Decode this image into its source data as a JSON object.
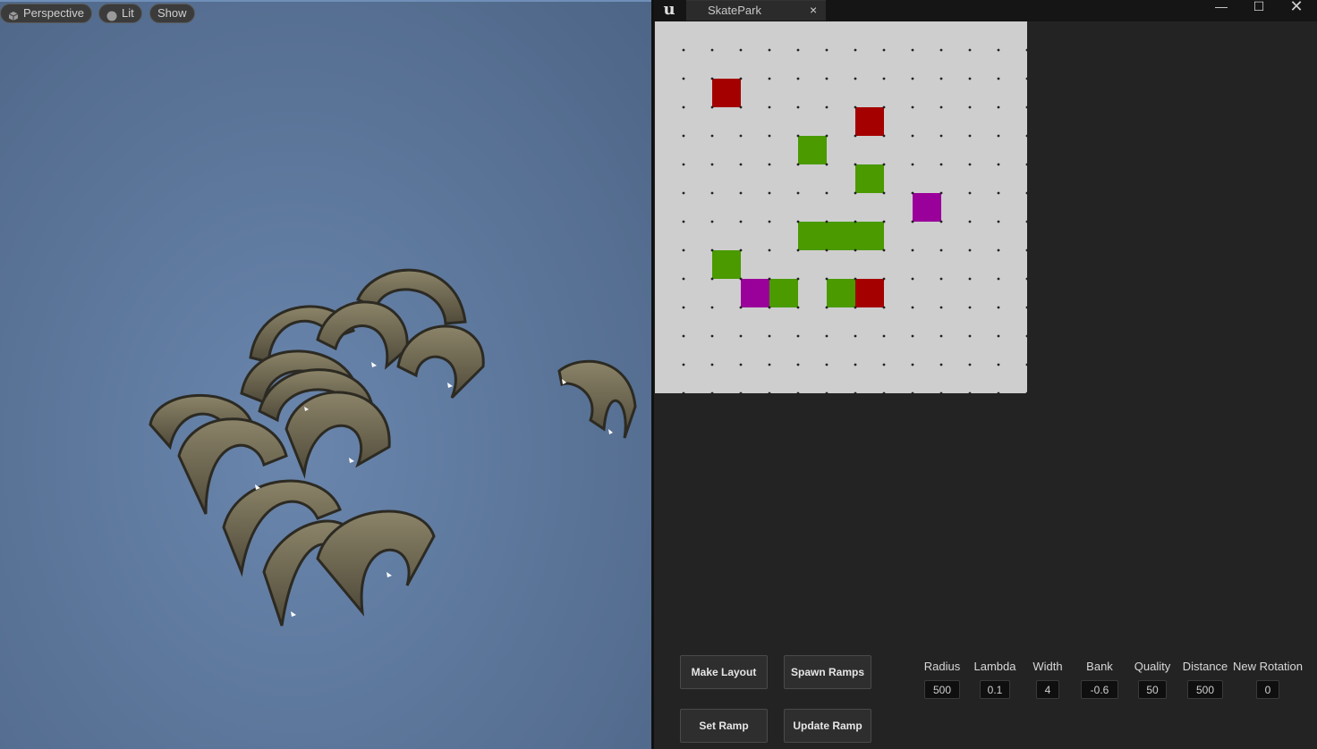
{
  "viewport": {
    "perspective_label": "Perspective",
    "lit_label": "Lit",
    "show_label": "Show"
  },
  "window": {
    "tab_title": "SkatePark",
    "tab_close": "×",
    "minimize": "—",
    "maximize": "☐",
    "close": "✕"
  },
  "grid": {
    "columns": 13,
    "rows": 13,
    "cells": [
      {
        "col": 2,
        "row": 2,
        "color": "#a50000"
      },
      {
        "col": 7,
        "row": 3,
        "color": "#a50000"
      },
      {
        "col": 5,
        "row": 4,
        "color": "#4a9a00"
      },
      {
        "col": 7,
        "row": 5,
        "color": "#4a9a00"
      },
      {
        "col": 9,
        "row": 6,
        "color": "#9a009a"
      },
      {
        "col": 5,
        "row": 7,
        "color": "#4a9a00"
      },
      {
        "col": 6,
        "row": 7,
        "color": "#4a9a00"
      },
      {
        "col": 7,
        "row": 7,
        "color": "#4a9a00"
      },
      {
        "col": 2,
        "row": 8,
        "color": "#4a9a00"
      },
      {
        "col": 3,
        "row": 9,
        "color": "#9a009a"
      },
      {
        "col": 4,
        "row": 9,
        "color": "#4a9a00"
      },
      {
        "col": 6,
        "row": 9,
        "color": "#4a9a00"
      },
      {
        "col": 7,
        "row": 9,
        "color": "#a50000"
      }
    ]
  },
  "buttons": {
    "make_layout": "Make Layout",
    "spawn_ramps": "Spawn Ramps",
    "set_ramp": "Set Ramp",
    "update_ramp": "Update Ramp"
  },
  "params": {
    "radius": {
      "label": "Radius",
      "value": "500"
    },
    "lambda": {
      "label": "Lambda",
      "value": "0.1"
    },
    "width": {
      "label": "Width",
      "value": "4"
    },
    "bank": {
      "label": "Bank",
      "value": "-0.6"
    },
    "quality": {
      "label": "Quality",
      "value": "50"
    },
    "distance": {
      "label": "Distance",
      "value": "500"
    },
    "new_rotation": {
      "label": "New Rotation",
      "value": "0"
    }
  },
  "colors": {
    "red": "#a50000",
    "green": "#4a9a00",
    "purple": "#9a009a",
    "ramp": "#726a55"
  }
}
